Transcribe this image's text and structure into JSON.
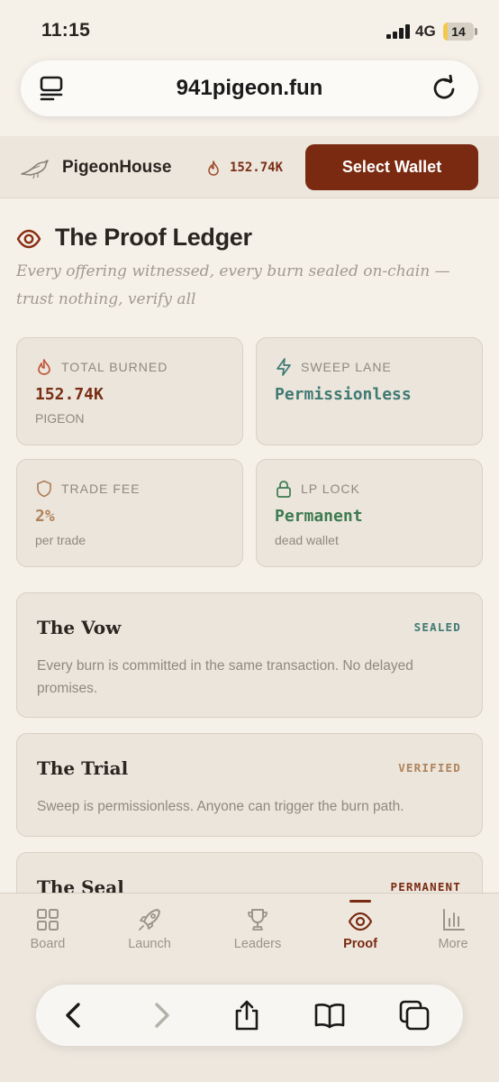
{
  "status": {
    "time": "11:15",
    "network": "4G",
    "battery": "14",
    "battery_level": 0.14
  },
  "browser": {
    "url": "941pigeon.fun"
  },
  "header": {
    "brand": "PigeonHouse",
    "burned": "152.74K",
    "wallet_button": "Select Wallet"
  },
  "page": {
    "title": "The Proof Ledger",
    "subtitle": "Every offering witnessed, every burn sealed on-chain — trust nothing, verify all"
  },
  "stats": [
    {
      "label": "TOTAL BURNED",
      "value": "152.74K",
      "sub": "PIGEON",
      "icon": "flame-icon",
      "color": "#7a2e14"
    },
    {
      "label": "SWEEP LANE",
      "value": "Permissionless",
      "sub": "",
      "icon": "bolt-icon",
      "color": "#3f7a73"
    },
    {
      "label": "TRADE FEE",
      "value": "2%",
      "sub": "per trade",
      "icon": "shield-icon",
      "color": "#b0825a"
    },
    {
      "label": "LP LOCK",
      "value": "Permanent",
      "sub": "dead wallet",
      "icon": "lock-icon",
      "color": "#3d7a4f"
    }
  ],
  "ledger": [
    {
      "title": "The Vow",
      "badge": "SEALED",
      "badge_color": "#3f7a73",
      "text": "Every burn is committed in the same transaction. No delayed promises."
    },
    {
      "title": "The Trial",
      "badge": "VERIFIED",
      "badge_color": "#b0825a",
      "text": "Sweep is permissionless. Anyone can trigger the burn path."
    },
    {
      "title": "The Seal",
      "badge": "PERMANENT",
      "badge_color": "#7a2a10",
      "text": ""
    }
  ],
  "tabs": [
    {
      "label": "Board",
      "icon": "grid-icon"
    },
    {
      "label": "Launch",
      "icon": "rocket-icon"
    },
    {
      "label": "Leaders",
      "icon": "trophy-icon"
    },
    {
      "label": "Proof",
      "icon": "eye-icon",
      "active": true
    },
    {
      "label": "More",
      "icon": "bar-chart-icon"
    }
  ]
}
